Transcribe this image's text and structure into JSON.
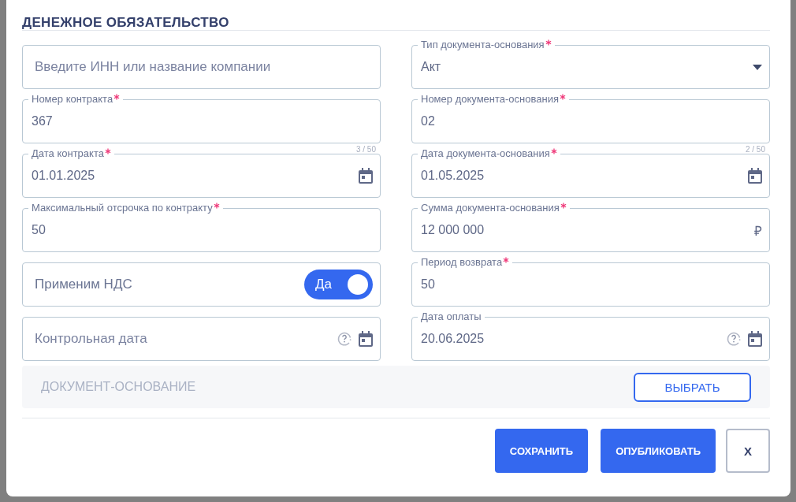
{
  "dialog": {
    "title": "ДЕНЕЖНОЕ ОБЯЗАТЕЛЬСТВО"
  },
  "left_fields": [
    {
      "kind": "text",
      "placeholder": "Введите ИНН или название компании"
    },
    {
      "kind": "text",
      "label": "Номер контракта",
      "required": true,
      "value": "367",
      "counter": "3 / 50"
    },
    {
      "kind": "date",
      "label": "Дата контракта",
      "required": true,
      "value": "01.01.2025",
      "help_icon": false
    },
    {
      "kind": "text",
      "label": "Максимальный отсрочка по контракту",
      "required": true,
      "value": "50"
    },
    {
      "kind": "toggle",
      "label": "Применим НДС",
      "toggle_label": "Да",
      "on": true
    },
    {
      "kind": "date",
      "placeholder": "Контрольная дата",
      "help_icon": true
    }
  ],
  "right_fields": [
    {
      "kind": "select",
      "label": "Тип документа-основания",
      "required": true,
      "value": "Акт"
    },
    {
      "kind": "text",
      "label": "Номер документа-основания",
      "required": true,
      "value": "02",
      "counter": "2 / 50"
    },
    {
      "kind": "date",
      "label": "Дата документа-основания",
      "required": true,
      "value": "01.05.2025",
      "help_icon": false
    },
    {
      "kind": "money",
      "label": "Сумма документа-основания",
      "required": true,
      "value": "12 000 000",
      "suffix": "₽"
    },
    {
      "kind": "text",
      "label": "Период возврата",
      "required": true,
      "value": "50"
    },
    {
      "kind": "date",
      "label": "Дата оплаты",
      "required": false,
      "value": "20.06.2025",
      "help_icon": true
    }
  ],
  "document_section": {
    "title": "ДОКУМЕНТ-ОСНОВАНИЕ",
    "button": "ВЫБРАТЬ"
  },
  "buttons": [
    {
      "kind": "primary",
      "label": "СОХРАНИТЬ"
    },
    {
      "kind": "primary",
      "label": "ОПУБЛИКОВАТЬ"
    },
    {
      "kind": "close",
      "label": "X"
    }
  ]
}
